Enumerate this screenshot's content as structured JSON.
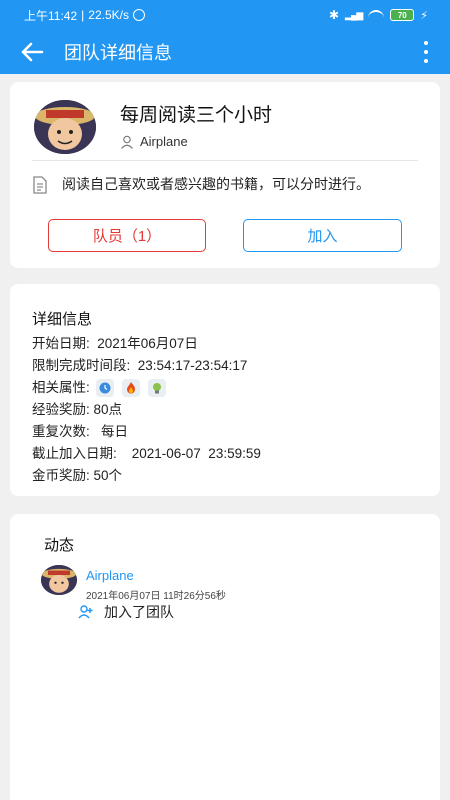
{
  "status_bar": {
    "time": "上午11:42",
    "net_speed": "22.5K/s",
    "battery": "70"
  },
  "header": {
    "title": "团队详细信息"
  },
  "team": {
    "title": "每周阅读三个小时",
    "creator": "Airplane",
    "description": "阅读自己喜欢或者感兴趣的书籍，可以分时进行。",
    "members_button": "队员（1）",
    "join_button": "加入"
  },
  "details": {
    "section_title": "详细信息",
    "start_date": "开始日期:  2021年06月07日",
    "time_limit": "限制完成时间段:  23:54:17-23:54:17",
    "attributes_label": "相关属性:",
    "attribute_icons": [
      "clock-icon",
      "fire-icon",
      "bulb-icon"
    ],
    "exp_reward": "经验奖励: 80点",
    "repeat_count": "重复次数:   每日",
    "join_deadline": "截止加入日期:    2021-06-07  23:59:59",
    "coin_reward": "金币奖励: 50个"
  },
  "activity": {
    "section_title": "动态",
    "items": [
      {
        "user": "Airplane",
        "time": "2021年06月07日 11时26分56秒",
        "action": "加入了团队"
      }
    ]
  },
  "colors": {
    "primary": "#2196f3",
    "danger": "#e53935",
    "background": "#f0f0f0"
  }
}
